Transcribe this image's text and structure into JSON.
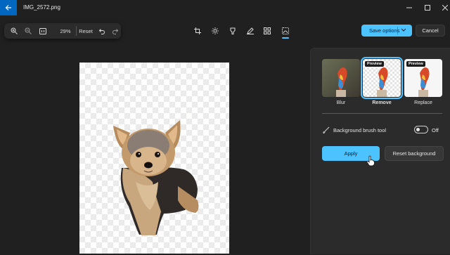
{
  "window": {
    "title": "IMG_2572.png",
    "controls": [
      "minimize-icon",
      "maximize-icon",
      "close-icon"
    ]
  },
  "toolbar": {
    "zoom_in_icon": "zoom-in-icon",
    "zoom_out_icon": "zoom-out-icon",
    "fit_icon": "actual-size-icon",
    "zoom_level": "29%",
    "reset_label": "Reset",
    "undo_icon": "undo-icon",
    "redo_icon": "redo-icon"
  },
  "tools": [
    {
      "name": "crop",
      "icon": "crop-icon"
    },
    {
      "name": "adjust",
      "icon": "brightness-icon"
    },
    {
      "name": "filter",
      "icon": "filter-icon"
    },
    {
      "name": "markup",
      "icon": "pen-icon"
    },
    {
      "name": "erase",
      "icon": "grid-icon"
    },
    {
      "name": "background",
      "icon": "background-icon",
      "active": true
    }
  ],
  "actions": {
    "save_label": "Save options",
    "cancel_label": "Cancel"
  },
  "panel": {
    "options": [
      {
        "label": "Blur",
        "badge": "",
        "selected": false
      },
      {
        "label": "Remove",
        "badge": "Preview",
        "selected": true
      },
      {
        "label": "Replace",
        "badge": "Preview",
        "selected": false
      }
    ],
    "brush_tool_label": "Background brush tool",
    "brush_toggle_state": "Off",
    "apply_label": "Apply",
    "reset_background_label": "Reset background"
  },
  "colors": {
    "accent": "#4cc2ff",
    "titlebar_accent": "#0067c0",
    "background": "#202020",
    "panel": "#2b2b2b"
  }
}
